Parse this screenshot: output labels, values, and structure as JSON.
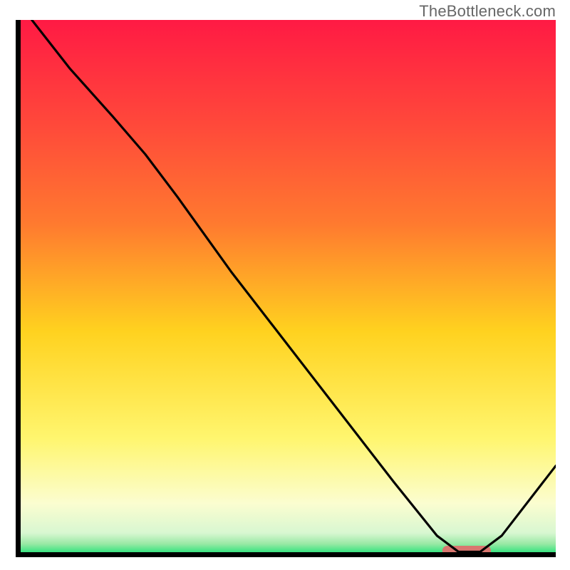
{
  "attribution": "TheBottleneck.com",
  "colors": {
    "gradient_top": "#ff1a44",
    "gradient_mid1": "#ff7a2f",
    "gradient_mid2": "#ffd21f",
    "gradient_mid3": "#fff66f",
    "gradient_mid4": "#fbfdd0",
    "gradient_bottom_pale": "#d8f7d1",
    "gradient_bottom": "#00e06a",
    "curve": "#000000",
    "marker": "#d9766f",
    "axis": "#000000"
  },
  "chart_data": {
    "type": "line",
    "title": "",
    "xlabel": "",
    "ylabel": "",
    "xlim": [
      0,
      100
    ],
    "ylim": [
      0,
      100
    ],
    "series": [
      {
        "name": "curve",
        "x": [
          3,
          10,
          18,
          24,
          30,
          40,
          50,
          60,
          70,
          78,
          82,
          86,
          90,
          100
        ],
        "y": [
          100,
          91,
          82,
          75,
          67,
          53,
          40,
          27,
          14,
          4,
          1,
          1,
          4,
          17
        ]
      }
    ],
    "marker": {
      "x_start": 79,
      "x_end": 88,
      "y": 1.2
    },
    "annotations": []
  }
}
